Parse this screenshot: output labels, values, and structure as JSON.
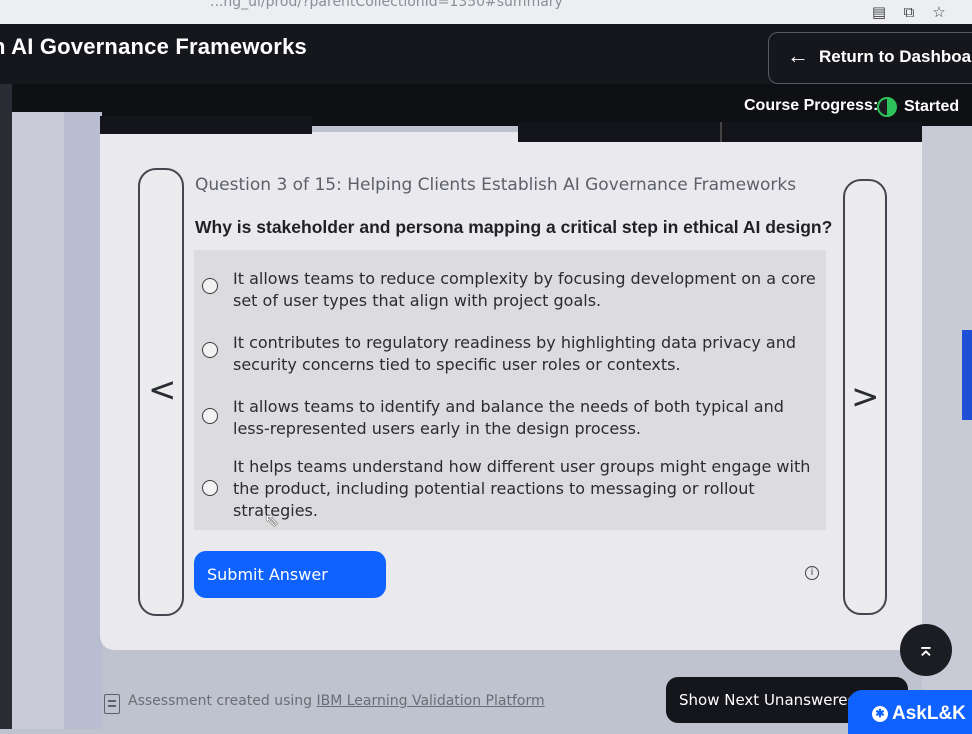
{
  "browser": {
    "url_fragment": "...ng_ui/prod/?parentCollectionId=1350#summary",
    "icons": [
      "reader-icon",
      "screen-cast-icon",
      "star-icon"
    ]
  },
  "header": {
    "title": "n AI Governance Frameworks",
    "return_label": "Return to Dashboar",
    "progress_label": "Course Progress:",
    "progress_status": "Started"
  },
  "question": {
    "title": "Question 3 of 15: Helping Clients Establish AI Governance Frameworks",
    "text": "Why is stakeholder and persona mapping a critical step in ethical AI design?",
    "options": [
      {
        "text": "It allows teams to reduce complexity by focusing development on a core set of user types that align with project goals.",
        "selected": false
      },
      {
        "text": "It contributes to regulatory readiness by highlighting data privacy and security concerns tied to specific user roles or contexts.",
        "selected": false
      },
      {
        "text": "It allows teams to identify and balance the needs of both typical and less-represented users early in the design process.",
        "selected": false
      },
      {
        "text": "It helps teams understand how different user groups might engage with the product, including potential reactions to messaging or rollout strategies.",
        "selected": false
      }
    ],
    "submit_label": "Submit Answer"
  },
  "nav": {
    "prev_glyph": "<",
    "next_glyph": ">"
  },
  "footer": {
    "assessment_prefix": "Assessment created using ",
    "assessment_link": "IBM Learning Validation Platform",
    "show_next_label": "Show Next Unanswered",
    "ask_label": "AskL&K"
  },
  "colors": {
    "primary_blue": "#0f62fe",
    "header_bg": "#16171c",
    "progress_green": "#2ec35a"
  }
}
